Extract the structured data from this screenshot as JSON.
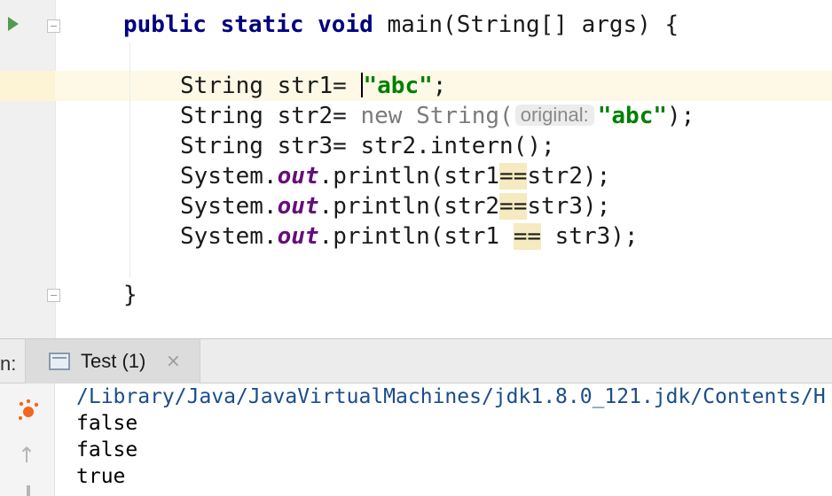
{
  "editor": {
    "lines": {
      "main_kw_public": "public",
      "main_kw_static": "static",
      "main_kw_void": "void",
      "main_sig": "main(String[] args) {",
      "l1_pre": "String str1= ",
      "l1_str": "\"abc\"",
      "l1_post": ";",
      "l2_pre": "String str2= ",
      "l2_new": "new",
      "l2_type": "String(",
      "l2_hint": "original:",
      "l2_str": "\"abc\"",
      "l2_post": ");",
      "l3": "String str3= str2.intern();",
      "l4_pre": "System.",
      "l4_out": "out",
      "l4_mid": ".println(str1",
      "l4_op": "==",
      "l4_post": "str2);",
      "l5_pre": "System.",
      "l5_out": "out",
      "l5_mid": ".println(str2",
      "l5_op": "==",
      "l5_post": "str3);",
      "l6_pre": "System.",
      "l6_out": "out",
      "l6_mid": ".println(str1 ",
      "l6_op": "==",
      "l6_post": " str3);",
      "close": "}"
    },
    "icons": {
      "run": "run-triangle-icon",
      "fold": "fold-minus-icon"
    }
  },
  "run_panel": {
    "label": "n:",
    "tab_label": "Test (1)",
    "tab_close": "×",
    "up_arrow": "↑"
  },
  "console": {
    "path": "/Library/Java/JavaVirtualMachines/jdk1.8.0_121.jdk/Contents/H",
    "output": [
      "false",
      "false",
      "true"
    ]
  },
  "colors": {
    "keyword": "#000080",
    "string": "#008000",
    "static_field": "#660e7a",
    "caret_row": "#fdf9e6",
    "match_highlight": "#f5eac0"
  }
}
